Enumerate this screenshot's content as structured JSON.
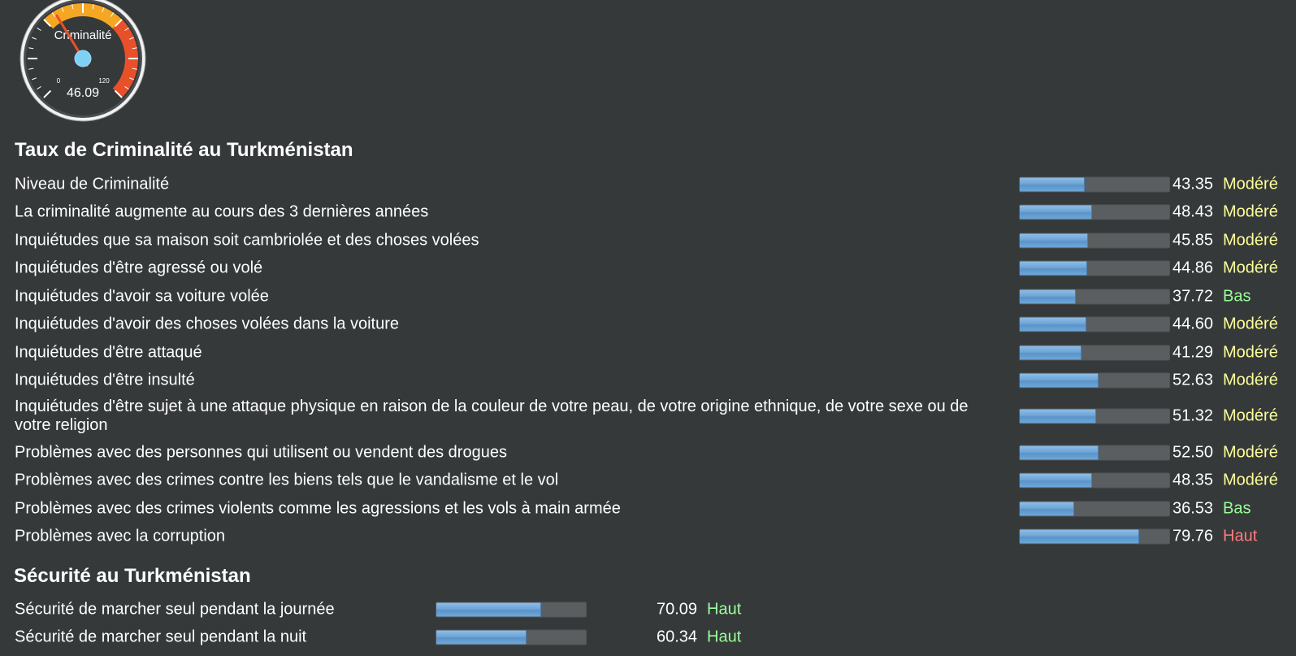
{
  "gauge": {
    "label": "Criminalité",
    "value": "46.09",
    "value_num": 46.09,
    "min_label": "0",
    "max_label": "120",
    "max": 120,
    "colors": {
      "face": "#35393a",
      "yellow": "#f5a623",
      "red": "#e8502a",
      "needle": "#e8502a",
      "hub": "#7fd0f5"
    }
  },
  "crime": {
    "title": "Taux de Criminalité au Turkménistan",
    "rows": [
      {
        "label": "Niveau de Criminalité",
        "value": "43.35",
        "pct": 43.35,
        "level": "Modéré"
      },
      {
        "label": "La criminalité augmente au cours des 3 dernières années",
        "value": "48.43",
        "pct": 48.43,
        "level": "Modéré"
      },
      {
        "label": "Inquiétudes que sa maison soit cambriolée et des choses volées",
        "value": "45.85",
        "pct": 45.85,
        "level": "Modéré"
      },
      {
        "label": "Inquiétudes d'être agressé ou volé",
        "value": "44.86",
        "pct": 44.86,
        "level": "Modéré"
      },
      {
        "label": "Inquiétudes d'avoir sa voiture volée",
        "value": "37.72",
        "pct": 37.72,
        "level": "Bas"
      },
      {
        "label": "Inquiétudes d'avoir des choses volées dans la voiture",
        "value": "44.60",
        "pct": 44.6,
        "level": "Modéré"
      },
      {
        "label": "Inquiétudes d'être attaqué",
        "value": "41.29",
        "pct": 41.29,
        "level": "Modéré"
      },
      {
        "label": "Inquiétudes d'être insulté",
        "value": "52.63",
        "pct": 52.63,
        "level": "Modéré"
      },
      {
        "label": "Inquiétudes d'être sujet à une attaque physique en raison de la couleur de votre peau, de votre origine ethnique, de votre sexe ou de votre religion",
        "value": "51.32",
        "pct": 51.32,
        "level": "Modéré"
      },
      {
        "label": "Problèmes avec des personnes qui utilisent ou vendent des drogues",
        "value": "52.50",
        "pct": 52.5,
        "level": "Modéré"
      },
      {
        "label": "Problèmes avec des crimes contre les biens tels que le vandalisme et le vol",
        "value": "48.35",
        "pct": 48.35,
        "level": "Modéré"
      },
      {
        "label": "Problèmes avec des crimes violents comme les agressions et les vols à main armée",
        "value": "36.53",
        "pct": 36.53,
        "level": "Bas"
      },
      {
        "label": "Problèmes avec la corruption",
        "value": "79.76",
        "pct": 79.76,
        "level": "Haut"
      }
    ]
  },
  "safety": {
    "title": "Sécurité au Turkménistan",
    "rows": [
      {
        "label": "Sécurité de marcher seul pendant la journée",
        "value": "70.09",
        "pct": 70.09,
        "level": "Haut"
      },
      {
        "label": "Sécurité de marcher seul pendant la nuit",
        "value": "60.34",
        "pct": 60.34,
        "level": "Haut"
      }
    ]
  },
  "level_colors": {
    "Modéré": "#ffff99",
    "Bas": "#99ff99",
    "Haut": "#ff7b7b",
    "Haut_safety": "#99ff99"
  }
}
